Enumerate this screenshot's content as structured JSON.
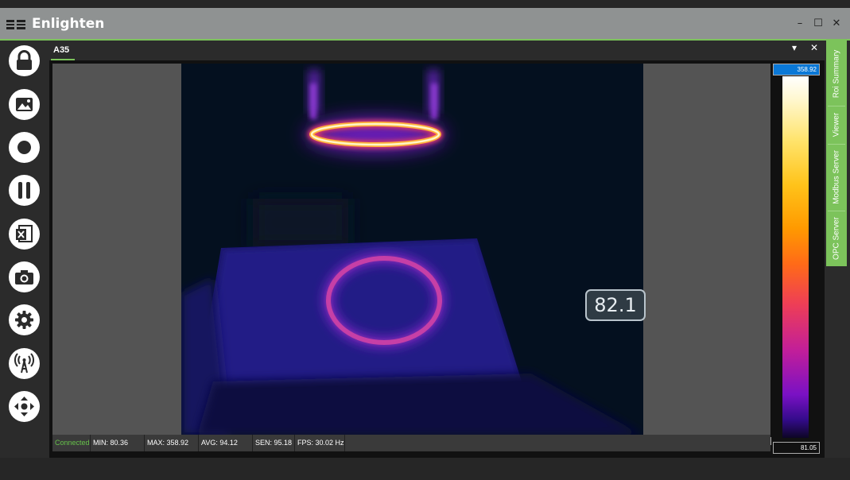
{
  "window": {
    "title": "Enlighten",
    "controls": [
      "–",
      "☐",
      "✕"
    ]
  },
  "toolbar": {
    "buttons": [
      "lock-icon",
      "image-icon",
      "record-icon",
      "pause-icon",
      "excel-export-icon",
      "camera-icon",
      "settings-gear-icon",
      "broadcast-tower-icon",
      "move-arrows-icon"
    ]
  },
  "tab": {
    "label": "A35",
    "menu_glyph": "▾",
    "close_glyph": "✕"
  },
  "roi": {
    "value": "82.1"
  },
  "status": {
    "connection": "Connected",
    "min": "MIN: 80.36",
    "max": "MAX: 358.92",
    "avg": "AVG: 94.12",
    "sen": "SEN: 95.18",
    "fps": "FPS: 30.02 Hz"
  },
  "scale": {
    "max": "358.92",
    "min": "81.05",
    "palette": [
      "#ffffff",
      "#ffe36a",
      "#ff9a00",
      "#ee3e56",
      "#c11e9a",
      "#7a11c4",
      "#0d0625"
    ]
  },
  "side_tabs": [
    "Roi Summary",
    "Viewer",
    "Modbus Server",
    "OPC Server"
  ],
  "colors": {
    "accent": "#7cc35b",
    "titlebar": "#8f9292",
    "scale_max_bg": "#0a78d7"
  }
}
